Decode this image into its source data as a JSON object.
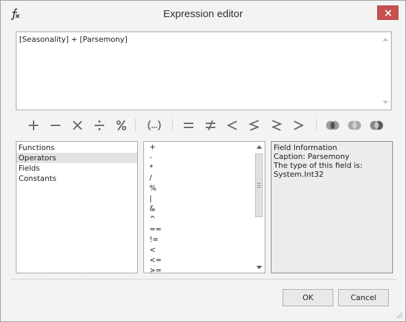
{
  "window": {
    "title": "Expression editor"
  },
  "expression": {
    "text": "[Seasonality] + [Parsemony]"
  },
  "toolbar": {
    "operators": [
      {
        "name": "plus-icon",
        "symbol": "+"
      },
      {
        "name": "minus-icon",
        "symbol": "−"
      },
      {
        "name": "multiply-icon",
        "symbol": "×"
      },
      {
        "name": "divide-icon",
        "symbol": "÷"
      },
      {
        "name": "percent-icon",
        "symbol": "%"
      },
      {
        "name": "parentheses-icon",
        "symbol": "(...)"
      },
      {
        "name": "equals-icon",
        "symbol": "="
      },
      {
        "name": "not-equal-icon",
        "symbol": "≠"
      },
      {
        "name": "less-than-icon",
        "symbol": "<"
      },
      {
        "name": "less-or-equal-icon",
        "symbol": "⩽"
      },
      {
        "name": "greater-or-equal-icon",
        "symbol": "⩾"
      },
      {
        "name": "greater-than-icon",
        "symbol": ">"
      },
      {
        "name": "and-icon",
        "symbol": ""
      },
      {
        "name": "or-icon",
        "symbol": ""
      },
      {
        "name": "not-icon",
        "symbol": ""
      }
    ]
  },
  "categories": {
    "items": [
      "Functions",
      "Operators",
      "Fields",
      "Constants"
    ],
    "selected": "Operators"
  },
  "operators_list": {
    "items": [
      "+",
      "-",
      "*",
      "/",
      "%",
      "|",
      "&",
      "^",
      "==",
      "!=",
      "<",
      "<=",
      ">="
    ]
  },
  "info": {
    "lines": [
      "Field Information",
      "Caption: Parsemony",
      "The type of this field is:",
      "System.Int32"
    ]
  },
  "buttons": {
    "ok": "OK",
    "cancel": "Cancel"
  },
  "colors": {
    "close": "#c75050",
    "icon": "#6a6a6a",
    "selection": "#e3e3e3"
  }
}
